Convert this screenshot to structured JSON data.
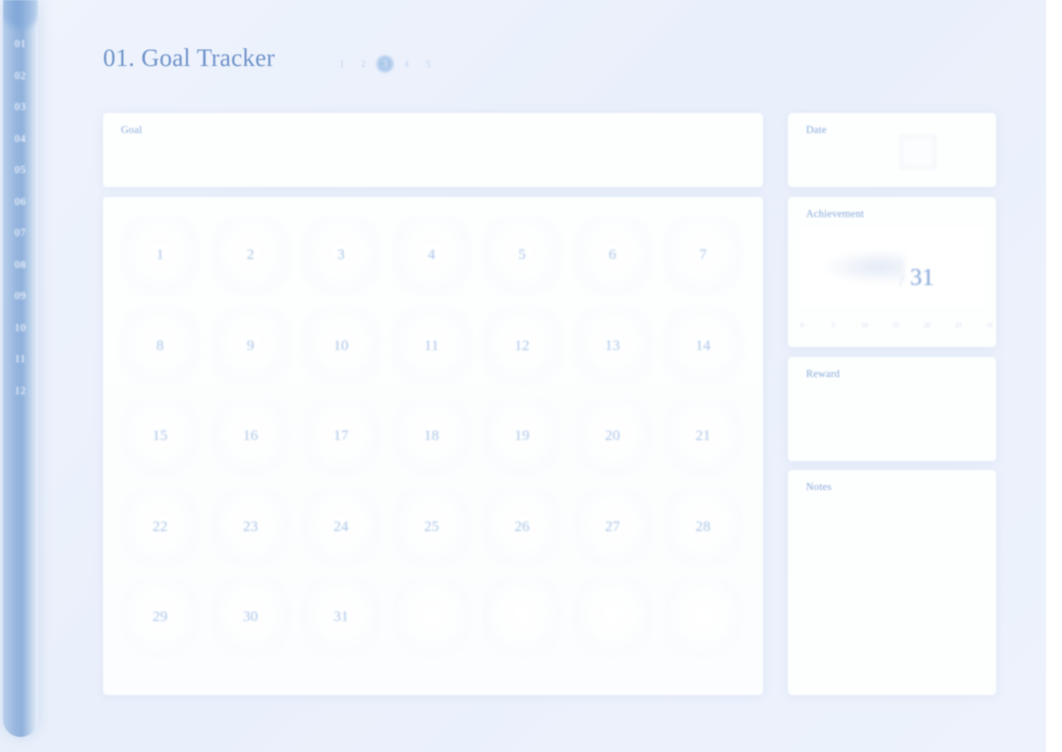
{
  "meta": {
    "accent": "#7fa3d6",
    "muted": "#a8c3e6",
    "label_color": "#86a8da",
    "background": "#eaf0fb",
    "sidebar_color": "#8fb1dc"
  },
  "sidebar": {
    "months": [
      "01",
      "02",
      "03",
      "04",
      "05",
      "06",
      "07",
      "08",
      "09",
      "10",
      "11",
      "12"
    ],
    "active_month": "01"
  },
  "header": {
    "title": "01. Goal Tracker",
    "pager": {
      "pages": [
        "1",
        "2",
        "3",
        "4",
        "5"
      ],
      "active": "3"
    }
  },
  "main": {
    "goal_card": {
      "label": "Goal",
      "value": ""
    },
    "calendar": {
      "days": [
        "1",
        "2",
        "3",
        "4",
        "5",
        "6",
        "7",
        "8",
        "9",
        "10",
        "11",
        "12",
        "13",
        "14",
        "15",
        "16",
        "17",
        "18",
        "19",
        "20",
        "21",
        "22",
        "23",
        "24",
        "25",
        "26",
        "27",
        "28",
        "29",
        "30",
        "31",
        "",
        "",
        "",
        ""
      ],
      "columns": 7,
      "rows": 5
    }
  },
  "side_panel": {
    "date_card": {
      "label": "Date",
      "value": ""
    },
    "achievement_card": {
      "label": "Achievement",
      "count": "",
      "separator": "/",
      "total": "31",
      "scale": [
        "0",
        "5",
        "10",
        "15",
        "20",
        "25",
        "31"
      ]
    },
    "reward_card": {
      "label": "Reward",
      "value": ""
    },
    "notes_card": {
      "label": "Notes",
      "value": ""
    }
  }
}
